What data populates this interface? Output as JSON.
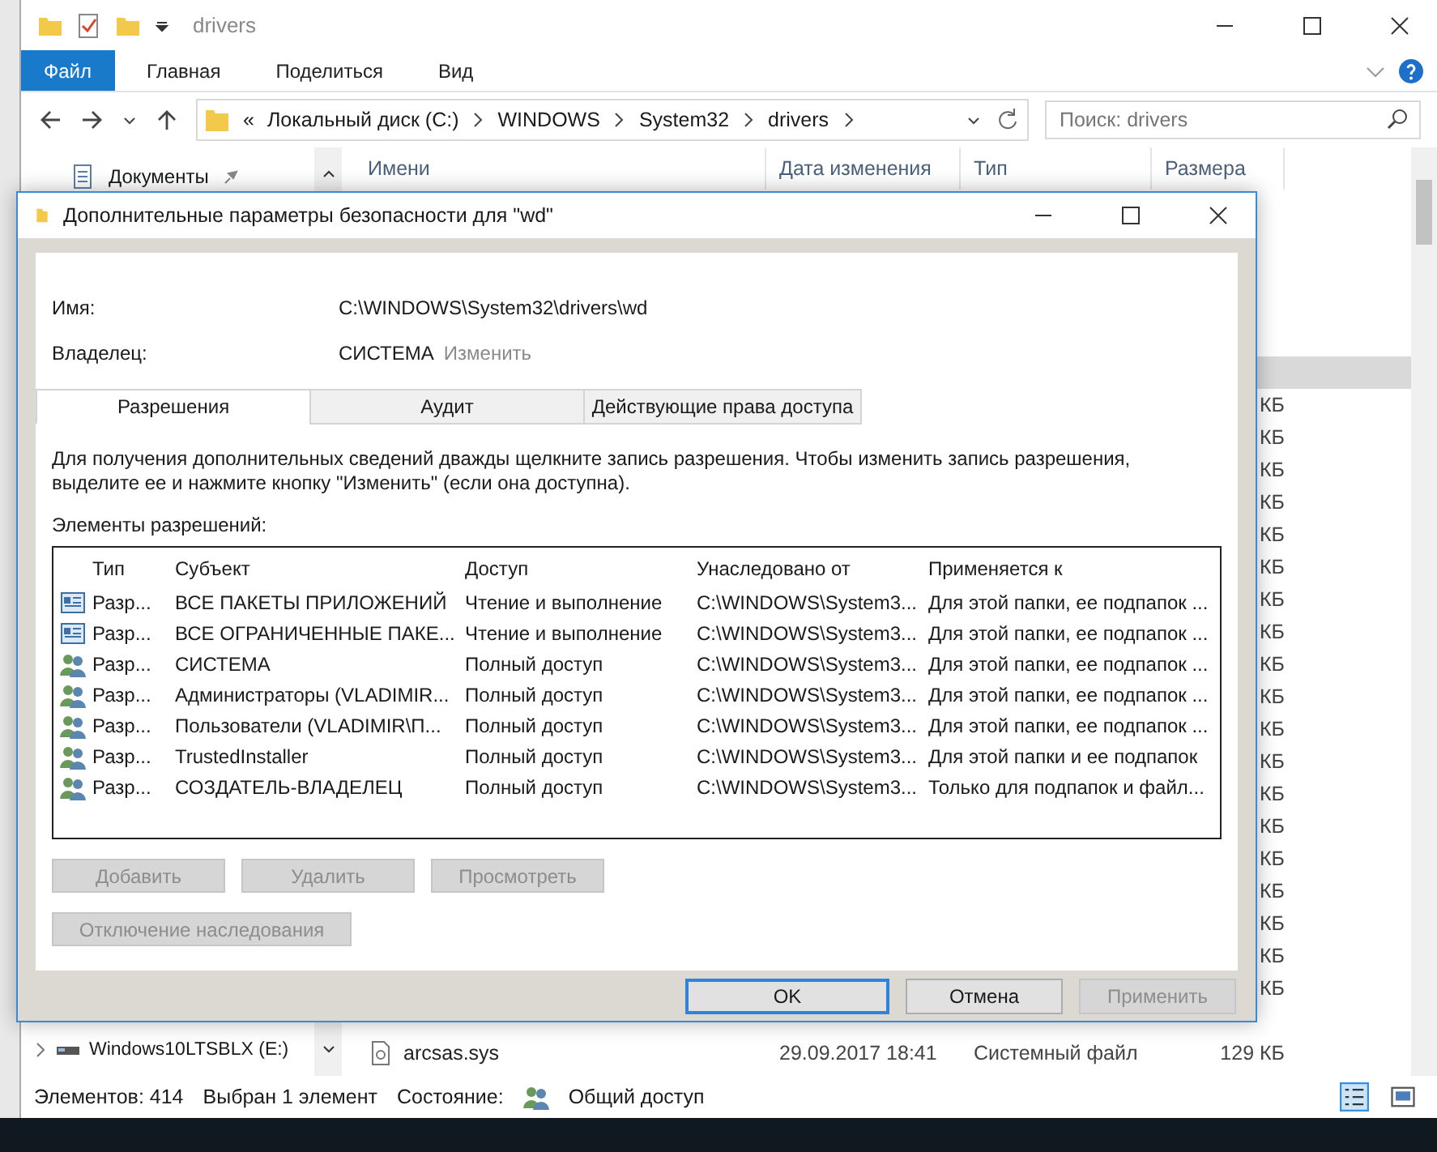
{
  "explorer": {
    "title": "drivers",
    "ribbon_tabs": [
      {
        "label": "Файл",
        "selected": true
      },
      {
        "label": "Главная",
        "selected": false
      },
      {
        "label": "Поделиться",
        "selected": false
      },
      {
        "label": "Вид",
        "selected": false
      }
    ],
    "breadcrumb": [
      "Локальный диск (C:)",
      "WINDOWS",
      "System32",
      "drivers"
    ],
    "breadcrumb_overflow": "«",
    "search": {
      "placeholder": "Поиск: drivers"
    },
    "nav_items": [
      {
        "label": "Документы",
        "kind": "documents"
      },
      {
        "label": "Windows10LTSBLX (E:)",
        "kind": "drive"
      }
    ],
    "columns": [
      "Имени",
      "Дата изменения",
      "Тип",
      "Размера"
    ],
    "rows": [
      {
        "selected": true
      },
      {
        "size": "КБ",
        "selected": false
      },
      {
        "size": "КБ",
        "selected": false
      },
      {
        "size": "КБ",
        "selected": false
      },
      {
        "size": "КБ",
        "selected": false
      },
      {
        "size": "КБ",
        "selected": false
      },
      {
        "size": "КБ",
        "selected": false
      },
      {
        "size": "КБ",
        "selected": false
      },
      {
        "size": "КБ",
        "selected": false
      },
      {
        "size": "КБ",
        "selected": false
      },
      {
        "size": "КБ",
        "selected": false
      },
      {
        "size": "КБ",
        "selected": false
      },
      {
        "size": "КБ",
        "selected": false
      },
      {
        "size": "КБ",
        "selected": false
      },
      {
        "size": "КБ",
        "selected": false
      },
      {
        "size": "КБ",
        "selected": false
      },
      {
        "size": "КБ",
        "selected": false
      },
      {
        "size": "КБ",
        "selected": false
      },
      {
        "size": "КБ",
        "selected": false
      },
      {
        "size": "КБ",
        "selected": false
      },
      {
        "selected": false
      },
      {
        "name": "arcsas.sys",
        "date": "29.09.2017 18:41",
        "type": "Системный файл",
        "size": "129 КБ",
        "selected": false
      }
    ],
    "status": {
      "count": "Элементов: 414",
      "selection": "Выбран 1 элемент",
      "state_label": "Состояние:",
      "state_value": "Общий доступ"
    }
  },
  "dialog": {
    "title": "Дополнительные параметры безопасности  для \"wd\"",
    "name_label": "Имя:",
    "name_value": "C:\\WINDOWS\\System32\\drivers\\wd",
    "owner_label": "Владелец:",
    "owner_value": "СИСТЕМА",
    "owner_change": {
      "label": "Изменить",
      "disabled": true
    },
    "tabs": [
      {
        "label": "Разрешения",
        "selected": true
      },
      {
        "label": "Аудит",
        "selected": false
      },
      {
        "label": "Действующие права доступа",
        "selected": false
      }
    ],
    "description": "Для получения дополнительных сведений дважды щелкните запись разрешения. Чтобы изменить запись разрешения, выделите ее и нажмите кнопку \"Изменить\" (если она доступна).",
    "list_label": "Элементы разрешений:",
    "columns": [
      "Тип",
      "Субъект",
      "Доступ",
      "Унаследовано от",
      "Применяется к"
    ],
    "entries": [
      {
        "kind": "package",
        "type": "Разр...",
        "subject": "ВСЕ ПАКЕТЫ ПРИЛОЖЕНИЙ",
        "access": "Чтение и выполнение",
        "inherited": "C:\\WINDOWS\\System3...",
        "applies": "Для этой папки, ее подпапок ..."
      },
      {
        "kind": "package",
        "type": "Разр...",
        "subject": "ВСЕ ОГРАНИЧЕННЫЕ ПАКЕ...",
        "access": "Чтение и выполнение",
        "inherited": "C:\\WINDOWS\\System3...",
        "applies": "Для этой папки, ее подпапок ..."
      },
      {
        "kind": "users",
        "type": "Разр...",
        "subject": "СИСТЕМА",
        "access": "Полный доступ",
        "inherited": "C:\\WINDOWS\\System3...",
        "applies": "Для этой папки, ее подпапок ..."
      },
      {
        "kind": "users",
        "type": "Разр...",
        "subject": "Администраторы (VLADIMIR...",
        "access": "Полный доступ",
        "inherited": "C:\\WINDOWS\\System3...",
        "applies": "Для этой папки, ее подпапок ..."
      },
      {
        "kind": "users",
        "type": "Разр...",
        "subject": "Пользователи (VLADIMIR\\П...",
        "access": "Полный доступ",
        "inherited": "C:\\WINDOWS\\System3...",
        "applies": "Для этой папки, ее подпапок ..."
      },
      {
        "kind": "users",
        "type": "Разр...",
        "subject": "TrustedInstaller",
        "access": "Полный доступ",
        "inherited": "C:\\WINDOWS\\System3...",
        "applies": "Для этой папки и ее подпапок"
      },
      {
        "kind": "users",
        "type": "Разр...",
        "subject": "СОЗДАТЕЛЬ-ВЛАДЕЛЕЦ",
        "access": "Полный доступ",
        "inherited": "C:\\WINDOWS\\System3...",
        "applies": "Только для подпапок и файл..."
      }
    ],
    "entry_buttons": [
      {
        "label": "Добавить",
        "disabled": true
      },
      {
        "label": "Удалить",
        "disabled": true
      },
      {
        "label": "Просмотреть",
        "disabled": true
      }
    ],
    "inherit_button": {
      "label": "Отключение наследования",
      "disabled": true
    },
    "footer_buttons": [
      {
        "label": "OK",
        "default": true,
        "disabled": false
      },
      {
        "label": "Отмена",
        "default": false,
        "disabled": false
      },
      {
        "label": "Применить",
        "default": false,
        "disabled": true
      }
    ]
  }
}
